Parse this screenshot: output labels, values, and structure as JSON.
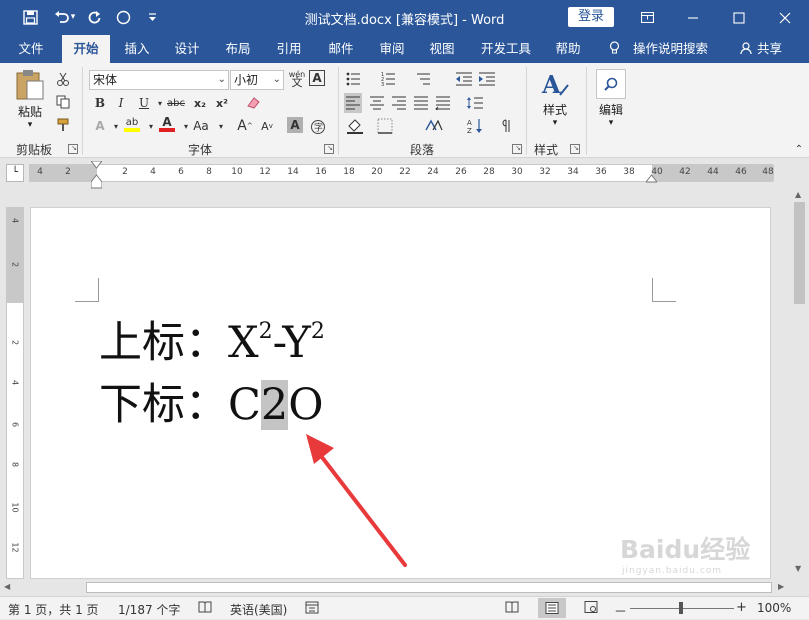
{
  "titlebar": {
    "doc_title": "测试文档.docx [兼容模式]  -  Word",
    "login_label": "登录",
    "quick_access": [
      "save-icon",
      "undo-icon",
      "redo-icon",
      "circle-icon",
      "customize-icon"
    ],
    "window_buttons": [
      "ribbon-display-icon",
      "minimize-icon",
      "maximize-icon",
      "close-icon"
    ],
    "bg_color": "#2b579a"
  },
  "tabs": {
    "file": "文件",
    "home": "开始",
    "insert": "插入",
    "design": "设计",
    "layout": "布局",
    "references": "引用",
    "mailings": "邮件",
    "review": "审阅",
    "view": "视图",
    "developer": "开发工具",
    "help": "帮助",
    "tell_me": "操作说明搜索",
    "share": "共享"
  },
  "ribbon": {
    "clipboard": {
      "label": "剪贴板",
      "paste": "粘贴"
    },
    "font": {
      "label": "字体",
      "font_name": "宋体",
      "font_size": "小初",
      "bold": "B",
      "italic": "I",
      "underline": "U",
      "strike": "abc",
      "subscript": "x₂",
      "superscript": "x²",
      "grow": "A",
      "shrink": "A",
      "case": "Aa",
      "highlight": "ab",
      "color": "A",
      "char_border": "A",
      "phonetic": "wén"
    },
    "paragraph": {
      "label": "段落"
    },
    "styles": {
      "label": "样式",
      "button": "样式"
    },
    "editing": {
      "button": "编辑"
    }
  },
  "ruler": {
    "h_numbers": [
      "4",
      "2",
      "2",
      "4",
      "6",
      "8",
      "10",
      "12",
      "14",
      "16",
      "18",
      "20",
      "22",
      "24",
      "26",
      "28",
      "30",
      "32",
      "34",
      "36",
      "38",
      "40",
      "42",
      "44",
      "46",
      "48"
    ],
    "v_numbers": [
      "4",
      "2",
      "2",
      "4",
      "6",
      "8",
      "10",
      "12"
    ]
  },
  "document": {
    "line1_prefix": "上标：X",
    "line1_sup1": "2",
    "line1_mid": "-Y",
    "line1_sup2": "2",
    "line2_prefix": "下标：C",
    "line2_selected": "2",
    "line2_suffix": "O"
  },
  "annotation": {
    "arrow_color": "#e8393b"
  },
  "status": {
    "page": "第 1 页，共 1 页",
    "words": "1/187 个字",
    "language": "英语(美国)",
    "zoom": "100%",
    "zoom_minus": "－",
    "zoom_plus": "+",
    "zoom_level": 1.0
  },
  "watermark": {
    "text": "Baidu经验",
    "sub": "jingyan.baidu.com"
  }
}
